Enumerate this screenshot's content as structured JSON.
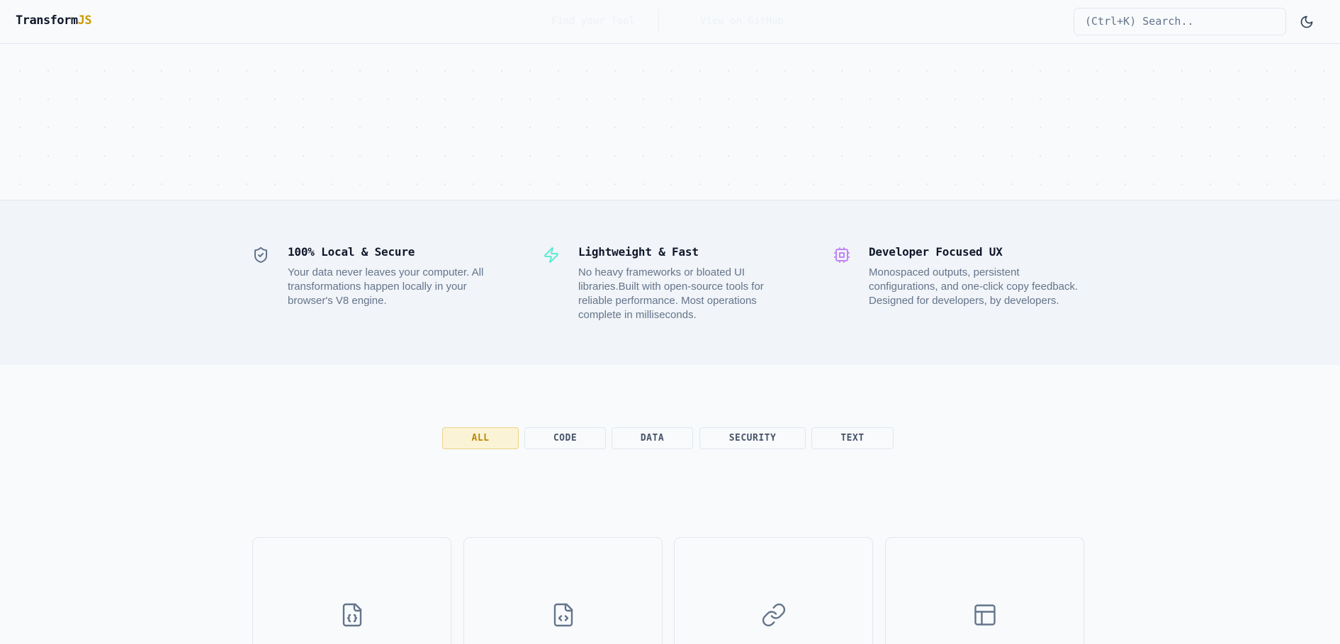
{
  "header": {
    "logo_main": "Transform",
    "logo_accent": "JS",
    "hero_primary": "Find your Tool",
    "hero_secondary": "View on GitHub",
    "search_placeholder": "(Ctrl+K) Search..",
    "theme_icon": "moon-icon"
  },
  "features": [
    {
      "icon": "shield-check-icon",
      "title": "100% Local & Secure",
      "text": "Your data never leaves your computer. All transformations happen locally in your browser's V8 engine."
    },
    {
      "icon": "zap-icon",
      "title": "Lightweight & Fast",
      "text": "No heavy frameworks or bloated UI libraries.Built with open-source tools for reliable performance. Most operations complete in milliseconds."
    },
    {
      "icon": "cpu-icon",
      "title": "Developer Focused UX",
      "text": "Monospaced outputs, persistent configurations, and one-click copy feedback. Designed for developers, by developers."
    }
  ],
  "filters": {
    "selected": "ALL",
    "items": [
      "ALL",
      "CODE",
      "DATA",
      "SECURITY",
      "TEXT"
    ]
  },
  "cards": [
    {
      "icon": "file-json-icon"
    },
    {
      "icon": "file-code-icon"
    },
    {
      "icon": "link-icon"
    },
    {
      "icon": "layout-icon"
    }
  ],
  "colors": {
    "accent": "#ca9a04",
    "zap": "#5eead4",
    "cpu": "#c084fc",
    "icon_gray": "#64748b"
  }
}
